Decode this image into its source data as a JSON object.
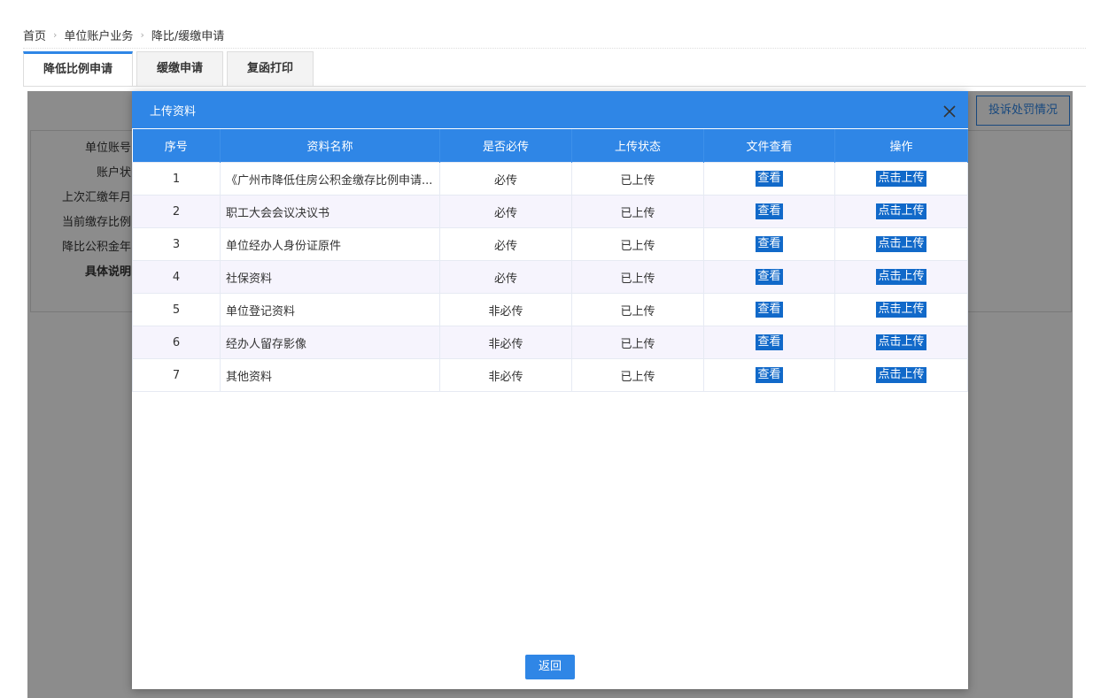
{
  "breadcrumb": [
    "首页",
    "单位账户业务",
    "降比/缓缴申请"
  ],
  "tabs": [
    {
      "label": "降低比例申请",
      "active": true
    },
    {
      "label": "缓缴申请",
      "active": false
    },
    {
      "label": "复函打印",
      "active": false
    }
  ],
  "background": {
    "complaint_button": "投诉处罚情况",
    "labels": [
      "单位账号",
      "账户状",
      "上次汇缴年月",
      "当前缴存比例",
      "降比公积金年",
      "具体说明"
    ]
  },
  "modal": {
    "title": "上传资料",
    "columns": [
      "序号",
      "资料名称",
      "是否必传",
      "上传状态",
      "文件查看",
      "操作"
    ],
    "rows": [
      {
        "no": "1",
        "name": "《广州市降低住房公积金缴存比例申请...",
        "required": "必传",
        "status": "已上传",
        "view": "查看",
        "action": "点击上传"
      },
      {
        "no": "2",
        "name": "职工大会会议决议书",
        "required": "必传",
        "status": "已上传",
        "view": "查看",
        "action": "点击上传"
      },
      {
        "no": "3",
        "name": "单位经办人身份证原件",
        "required": "必传",
        "status": "已上传",
        "view": "查看",
        "action": "点击上传"
      },
      {
        "no": "4",
        "name": "社保资料",
        "required": "必传",
        "status": "已上传",
        "view": "查看",
        "action": "点击上传"
      },
      {
        "no": "5",
        "name": "单位登记资料",
        "required": "非必传",
        "status": "已上传",
        "view": "查看",
        "action": "点击上传"
      },
      {
        "no": "6",
        "name": "经办人留存影像",
        "required": "非必传",
        "status": "已上传",
        "view": "查看",
        "action": "点击上传"
      },
      {
        "no": "7",
        "name": "其他资料",
        "required": "非必传",
        "status": "已上传",
        "view": "查看",
        "action": "点击上传"
      }
    ],
    "return_label": "返回"
  },
  "colors": {
    "accent": "#2f86e6",
    "required": "#e0241b",
    "uploaded": "#1a8a1a",
    "action_bg": "#1169c9"
  }
}
